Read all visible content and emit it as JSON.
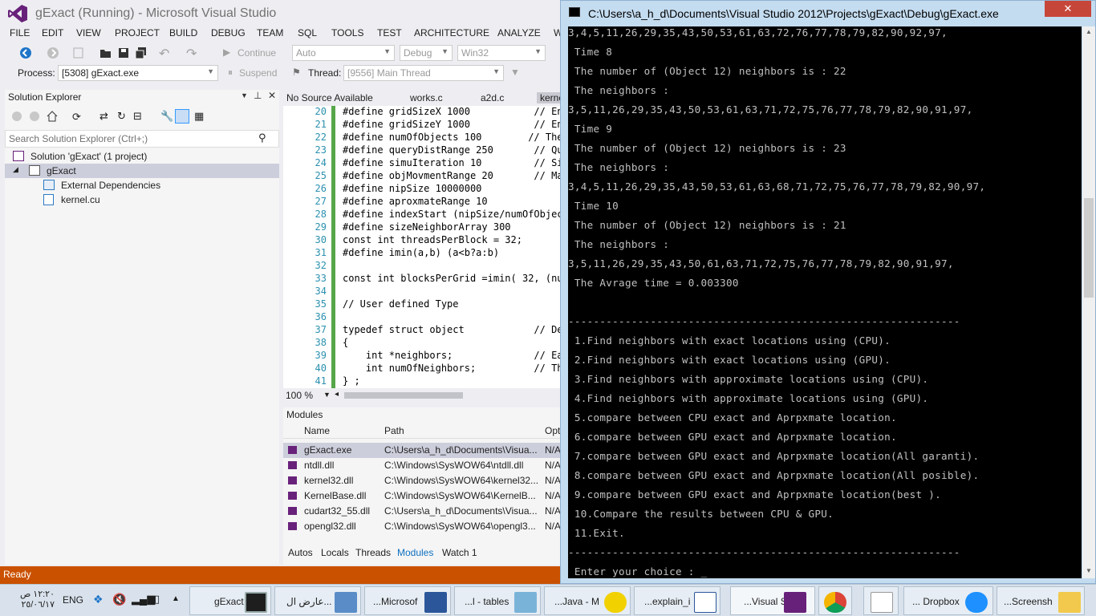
{
  "vs": {
    "title": "gExact (Running) - Microsoft Visual Studio",
    "menu": [
      "FILE",
      "EDIT",
      "VIEW",
      "PROJECT",
      "BUILD",
      "DEBUG",
      "TEAM",
      "SQL",
      "TOOLS",
      "TEST",
      "ARCHITECTURE",
      "ANALYZE",
      "W"
    ],
    "toolbar": {
      "continue_label": "Continue",
      "auto_label": "Auto",
      "config": "Debug",
      "platform": "Win32",
      "process_label": "Process:",
      "process_value": "[5308] gExact.exe",
      "suspend_label": "Suspend",
      "thread_label": "Thread:",
      "thread_value": "[9556] Main Thread"
    },
    "solution_explorer": {
      "title": "Solution Explorer",
      "search_placeholder": "Search Solution Explorer (Ctrl+;)",
      "items": [
        {
          "label": "Solution 'gExact' (1 project)"
        },
        {
          "label": "gExact"
        },
        {
          "label": "External Dependencies"
        },
        {
          "label": "kernel.cu"
        }
      ]
    },
    "editor": {
      "tabs": [
        "No Source Available",
        "works.c",
        "a2d.c",
        "kerne"
      ],
      "zoom": "100 %",
      "lines": [
        {
          "n": "20",
          "code": "#define gridSizeX 1000           // Env"
        },
        {
          "n": "21",
          "code": "#define gridSizeY 1000           // Env"
        },
        {
          "n": "22",
          "code": "#define numOfObjects 100        // The"
        },
        {
          "n": "23",
          "code": "#define queryDistRange 250       // Que"
        },
        {
          "n": "24",
          "code": "#define simuIteration 10         // Sim"
        },
        {
          "n": "25",
          "code": "#define objMovmentRange 20       // Max"
        },
        {
          "n": "26",
          "code": "#define nipSize 10000000"
        },
        {
          "n": "27",
          "code": "#define aproxmateRange 10"
        },
        {
          "n": "28",
          "code": "#define indexStart (nipSize/numOfObject"
        },
        {
          "n": "29",
          "code": "#define sizeNeighborArray 300"
        },
        {
          "n": "30",
          "code": "const int threadsPerBlock = 32;"
        },
        {
          "n": "31",
          "code": "#define imin(a,b) (a<b?a:b)"
        },
        {
          "n": "32",
          "code": ""
        },
        {
          "n": "33",
          "code": "const int blocksPerGrid =imin( 32, (num"
        },
        {
          "n": "34",
          "code": ""
        },
        {
          "n": "35",
          "code": "// User defined Type"
        },
        {
          "n": "36",
          "code": ""
        },
        {
          "n": "37",
          "code": "typedef struct object            // Def"
        },
        {
          "n": "38",
          "code": "{"
        },
        {
          "n": "39",
          "code": "    int *neighbors;              // Eac"
        },
        {
          "n": "40",
          "code": "    int numOfNeighbors;          // The"
        },
        {
          "n": "41",
          "code": "} ;"
        }
      ]
    },
    "modules": {
      "title": "Modules",
      "headers": [
        "Name",
        "Path",
        "Opt"
      ],
      "rows": [
        {
          "name": "gExact.exe",
          "path": "C:\\Users\\a_h_d\\Documents\\Visua...",
          "opt": "N/A"
        },
        {
          "name": "ntdll.dll",
          "path": "C:\\Windows\\SysWOW64\\ntdll.dll",
          "opt": "N/A"
        },
        {
          "name": "kernel32.dll",
          "path": "C:\\Windows\\SysWOW64\\kernel32...",
          "opt": "N/A"
        },
        {
          "name": "KernelBase.dll",
          "path": "C:\\Windows\\SysWOW64\\KernelB...",
          "opt": "N/A"
        },
        {
          "name": "cudart32_55.dll",
          "path": "C:\\Users\\a_h_d\\Documents\\Visua...",
          "opt": "N/A"
        },
        {
          "name": "opengl32.dll",
          "path": "C:\\Windows\\SysWOW64\\opengl3...",
          "opt": "N/A"
        }
      ]
    },
    "debug_tabs": [
      "Autos",
      "Locals",
      "Threads",
      "Modules",
      "Watch 1"
    ],
    "status": "Ready"
  },
  "console": {
    "title": "C:\\Users\\a_h_d\\Documents\\Visual Studio 2012\\Projects\\gExact\\Debug\\gExact.exe",
    "close_label": "✕",
    "lines": [
      "3,4,5,11,26,29,35,43,50,53,61,63,72,76,77,78,79,82,90,92,97,",
      " Time 8",
      " The number of (Object 12) neighbors is : 22",
      " The neighbors :",
      "3,5,11,26,29,35,43,50,53,61,63,71,72,75,76,77,78,79,82,90,91,97,",
      " Time 9",
      " The number of (Object 12) neighbors is : 23",
      " The neighbors :",
      "3,4,5,11,26,29,35,43,50,53,61,63,68,71,72,75,76,77,78,79,82,90,97,",
      " Time 10",
      " The number of (Object 12) neighbors is : 21",
      " The neighbors :",
      "3,5,11,26,29,35,43,50,61,63,71,72,75,76,77,78,79,82,90,91,97,",
      " The Avrage time = 0.003300",
      "",
      "--------------------------------------------------------------",
      " 1.Find neighbors with exact locations using (CPU).",
      " 2.Find neighbors with exact locations using (GPU).",
      " 3.Find neighbors with approximate locations using (CPU).",
      " 4.Find neighbors with approximate locations using (GPU).",
      " 5.compare between CPU exact and Aprpxmate location.",
      " 6.compare between GPU exact and Aprpxmate location.",
      " 7.compare between GPU exact and Aprpxmate location(All garanti).",
      " 8.compare between GPU exact and Aprpxmate location(All posible).",
      " 9.compare between GPU exact and Aprpxmate location(best ).",
      " 10.Compare the results between CPU & GPU.",
      " 11.Exit.",
      "--------------------------------------------------------------",
      " Enter your choice : _"
    ]
  },
  "taskbar": {
    "clock_time": "١٢:٢٠ ص",
    "clock_date": "٢٥/٠٦/١٧",
    "lang": "ENG",
    "buttons": [
      {
        "label": "gExact"
      },
      {
        "label": "عارض ال..."
      },
      {
        "label": "...Microsof"
      },
      {
        "label": "...l - tables"
      },
      {
        "label": "...Java - M"
      },
      {
        "label": "...explain_i"
      },
      {
        "label": "...Visual S"
      },
      {
        "label": ""
      },
      {
        "label": ""
      },
      {
        "label": "... Dropbox"
      },
      {
        "label": "...Screensh"
      }
    ]
  },
  "colors": {
    "status_bar": "#ca5100",
    "console_bg": "#000000",
    "console_fg": "#c0c0c0",
    "vs_accent": "#68217a"
  }
}
